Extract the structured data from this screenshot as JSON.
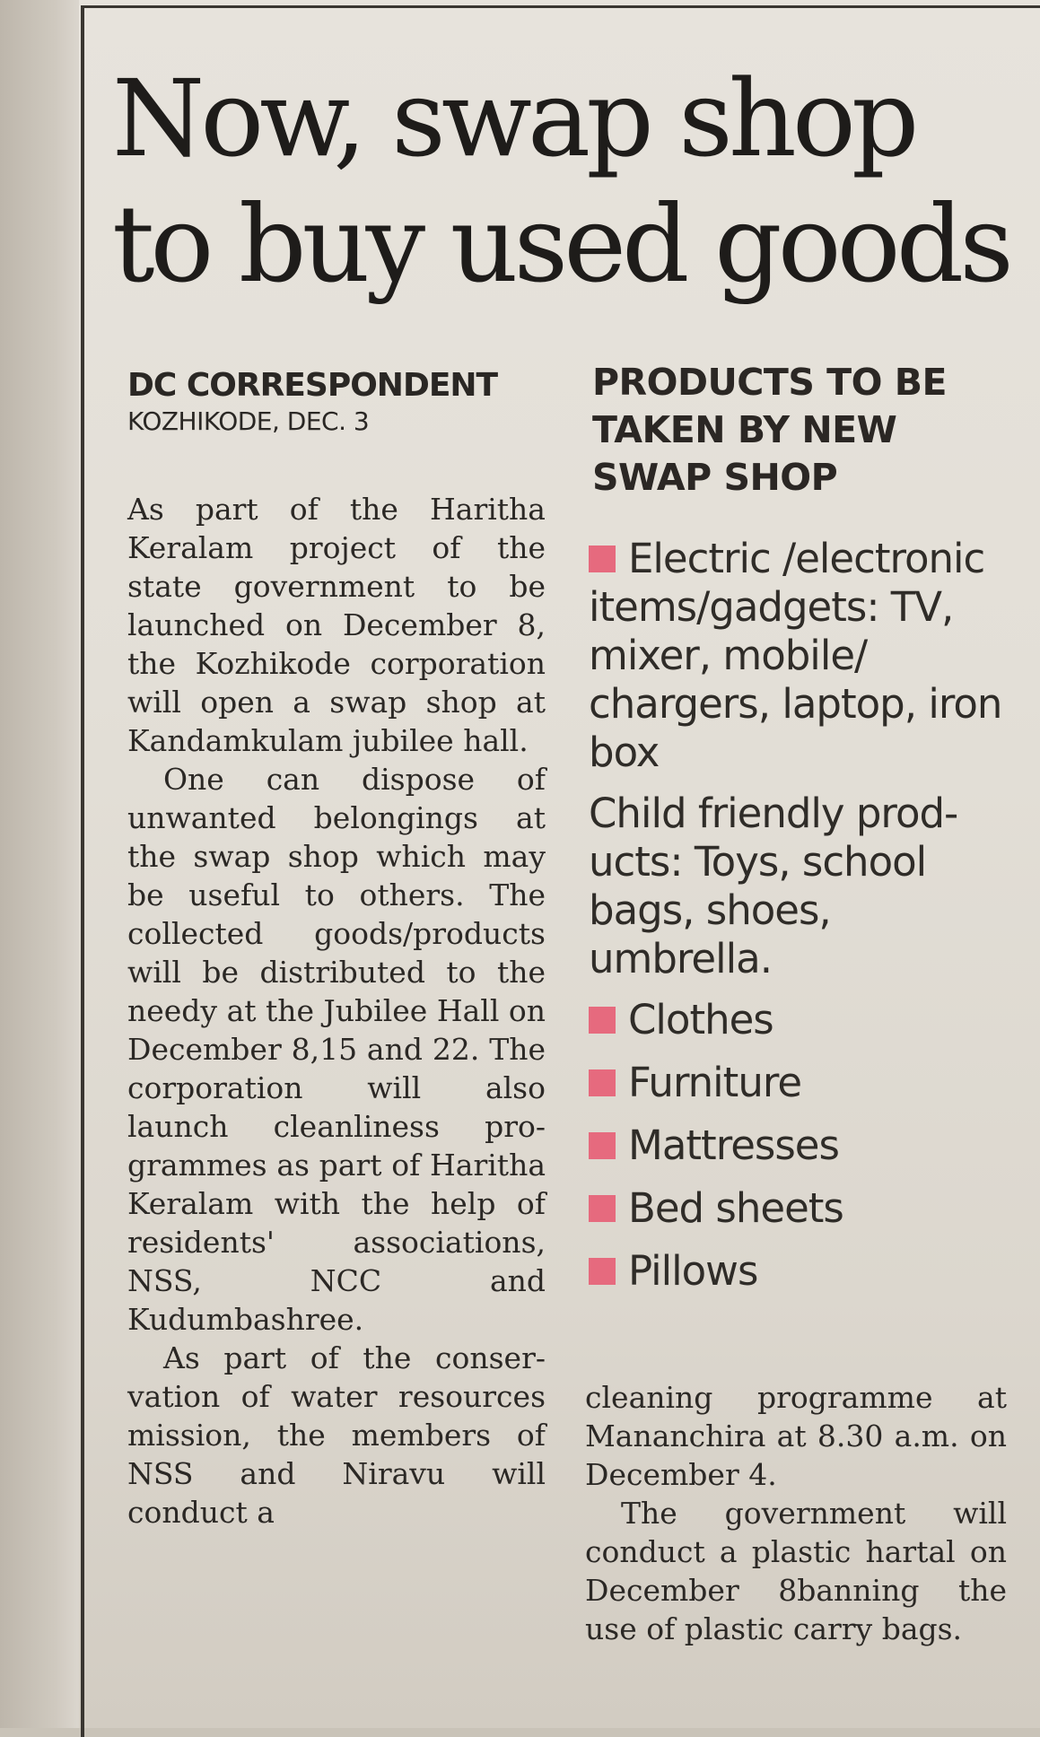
{
  "article": {
    "headline": "Now, swap shop to buy used goods",
    "byline": "DC CORRESPONDENT",
    "dateline": "KOZHIKODE, DEC. 3",
    "paragraphs_left": [
      "As part of the Haritha Keralam project of the state government to be launched on December 8, the Kozhikode cor­poration will open a swap shop at Kandamkulam jubilee hall.",
      "One can dispose of unwanted belongings at the swap shop which may be useful to oth­ers. The collected goods/products will be distributed to the needy at the Jubilee Hall on December 8,15 and 22. The corpora­tion will also launch cleanliness pro­grammes as part of Haritha Keralam with the help of residents' associations, NSS, NC­C and Kudumbashree.",
      "As part of the conser­vation of water resources mission, the members of NSS and Niravu will conduct a"
    ],
    "paragraphs_right": [
      "cleaning programme at Mananchira at 8.30 a.m. on December 4.",
      "The government will conduct a plastic har­tal on December 8ban­ning the use of plastic carry bags."
    ]
  },
  "sidebar": {
    "title": "PRODUCTS TO BE TAKEN BY NEW SWAP SHOP",
    "items": [
      "Electric /elec­tronic items/gadg­ets: TV, mixer, mobile/ chargers, laptop, iron box",
      "Child friendly prod­ucts: Toys, school bags, shoes, umbrella.",
      "Clothes",
      "Furniture",
      "Mattresses",
      "Bed sheets",
      "Pillows"
    ],
    "bullet_color": "#e66a7e"
  }
}
